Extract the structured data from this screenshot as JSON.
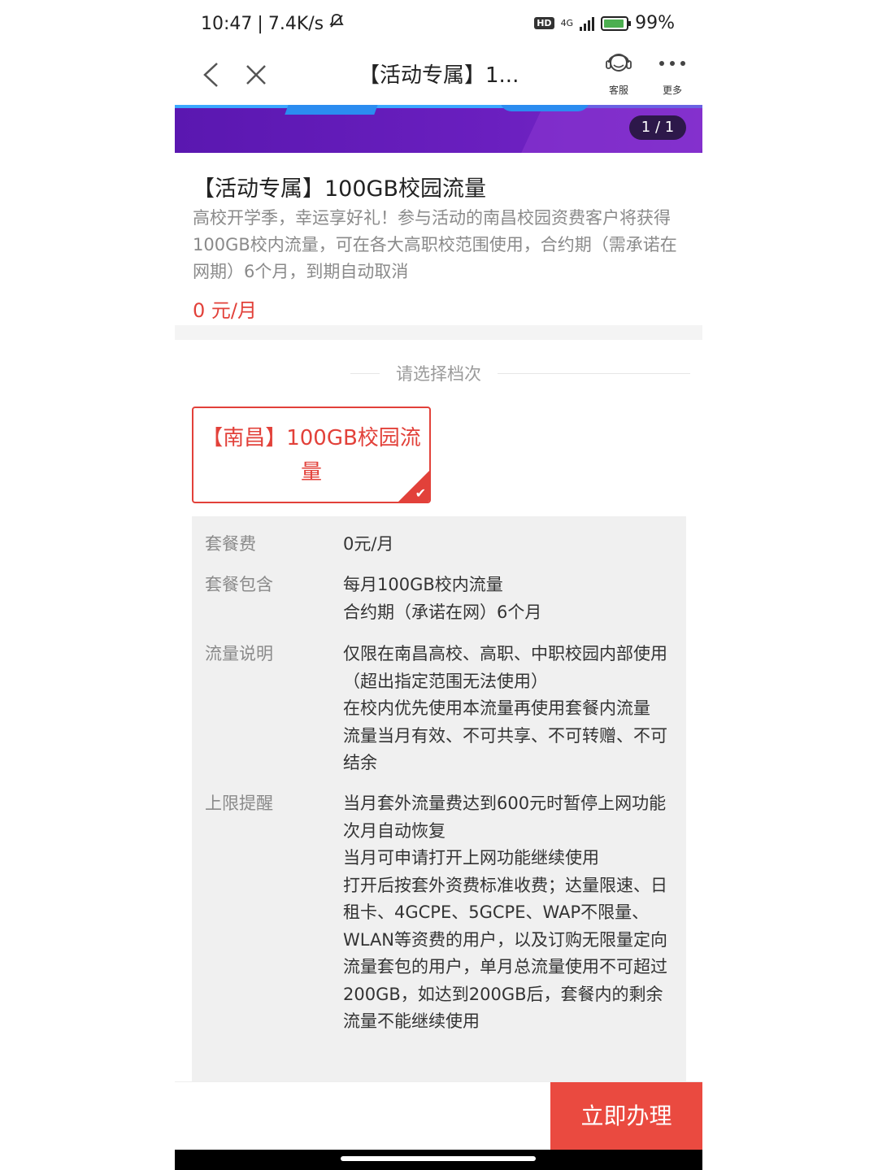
{
  "status_bar": {
    "time": "10:47",
    "speed": "7.4K/s",
    "network": "4G",
    "hd": "HD",
    "battery": "99%"
  },
  "nav": {
    "title": "【活动专属】1...",
    "service_label": "客服",
    "more_label": "更多"
  },
  "banner": {
    "pager": "1 / 1"
  },
  "product": {
    "title": "【活动专属】100GB校园流量",
    "description": "高校开学季，幸运享好礼！参与活动的南昌校园资费客户将获得100GB校内流量，可在各大高职校范围使用，合约期（需承诺在网期）6个月，到期自动取消",
    "price": "0 元/月"
  },
  "tier": {
    "heading": "请选择档次",
    "option_label": "【南昌】100GB校园流量"
  },
  "details": {
    "fee_label": "套餐费",
    "fee_value": "0元/月",
    "includes_label": "套餐包含",
    "includes_lines": [
      "每月100GB校内流量",
      "合约期（承诺在网）6个月"
    ],
    "traffic_label": "流量说明",
    "traffic_lines": [
      "仅限在南昌高校、高职、中职校园内部使用（超出指定范围无法使用）",
      "在校内优先使用本流量再使用套餐内流量",
      "流量当月有效、不可共享、不可转赠、不可结余"
    ],
    "limit_label": "上限提醒",
    "limit_lines": [
      "当月套外流量费达到600元时暂停上网功能",
      "次月自动恢复",
      "当月可申请打开上网功能继续使用",
      "打开后按套外资费标准收费；达量限速、日租卡、4GCPE、5GCPE、WAP不限量、WLAN等资费的用户，以及订购无限量定向流量套包的用户，单月总流量使用不可超过200GB，如达到200GB后，套餐内的剩余流量不能继续使用"
    ]
  },
  "bottom": {
    "cta_label": "立即办理"
  },
  "colors": {
    "accent": "#e2413a",
    "cta": "#ea4a40",
    "banner": "#5a17b0"
  }
}
